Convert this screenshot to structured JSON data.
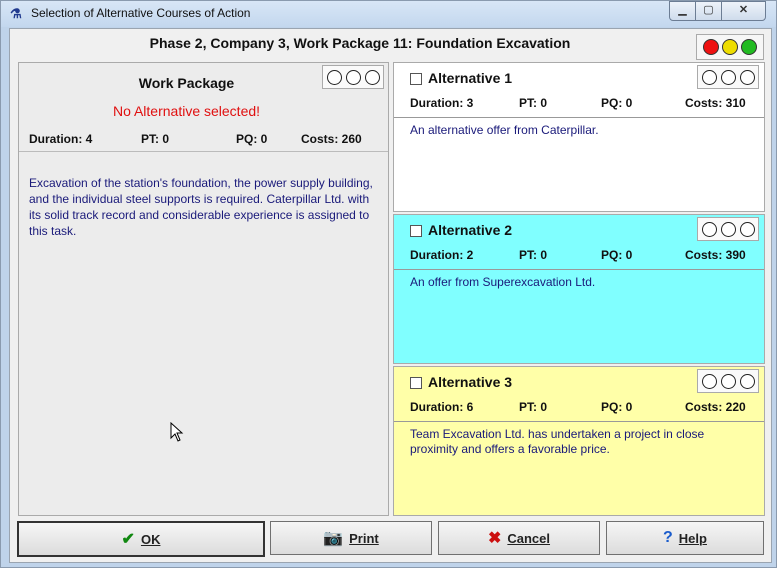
{
  "window": {
    "title": "Selection of Alternative Courses of Action",
    "app_icon": "app-icon",
    "controls": {
      "minimize": "▭",
      "maximize": "▣",
      "close": "✕"
    }
  },
  "header": {
    "title": "Phase 2, Company 3, Work Package 11: Foundation Excavation",
    "traffic_lights": [
      "#ee1111",
      "#eedd00",
      "#22bb22"
    ]
  },
  "work_package": {
    "title": "Work Package",
    "warning": "No Alternative selected!",
    "duration": "Duration: 4",
    "pt": "PT: 0",
    "pq": "PQ: 0",
    "costs": "Costs: 260",
    "description": "Excavation of the station's foundation, the power supply building, and the individual steel supports is required. Caterpillar Ltd. with its solid track record and considerable experience is assigned to this task."
  },
  "alternatives": [
    {
      "title": "Alternative 1",
      "duration": "Duration: 3",
      "pt": "PT: 0",
      "pq": "PQ: 0",
      "costs": "Costs: 310",
      "description": "An alternative offer from Caterpillar.",
      "color": "#ffffff"
    },
    {
      "title": "Alternative 2",
      "duration": "Duration: 2",
      "pt": "PT: 0",
      "pq": "PQ: 0",
      "costs": "Costs: 390",
      "description": "An offer from Superexcavation Ltd.",
      "color": "#80ffff"
    },
    {
      "title": "Alternative 3",
      "duration": "Duration: 6",
      "pt": "PT: 0",
      "pq": "PQ: 0",
      "costs": "Costs: 220",
      "description": "Team Excavation Ltd. has undertaken a project in close proximity and offers a favorable price.",
      "color": "#ffffa8"
    }
  ],
  "buttons": {
    "ok": {
      "label": "OK",
      "icon": "checkmark-icon"
    },
    "print": {
      "label": "Print",
      "icon": "camera-icon"
    },
    "cancel": {
      "label": "Cancel",
      "icon": "x-icon"
    },
    "help": {
      "label": "Help",
      "icon": "question-icon"
    }
  }
}
